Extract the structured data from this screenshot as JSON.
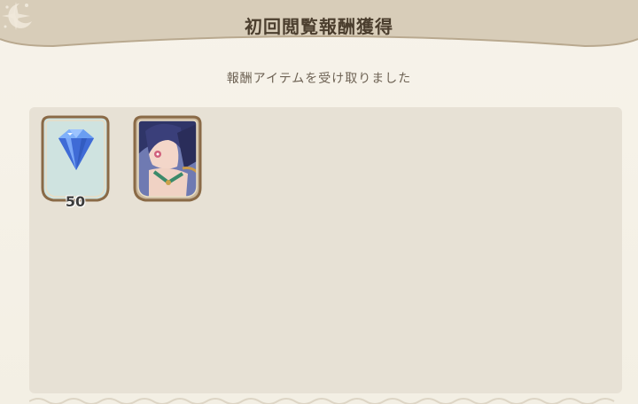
{
  "dialog": {
    "title": "初回閲覧報酬獲得",
    "message": "報酬アイテムを受け取りました"
  },
  "rewards": [
    {
      "item": "gem",
      "icon": "gem-icon",
      "quantity": "50"
    },
    {
      "item": "character",
      "icon": "character-portrait"
    }
  ],
  "colors": {
    "banner": "#d8cdb9",
    "banner_border": "#b9a98f",
    "title_text": "#4b3e2e",
    "panel": "#e7e1d5",
    "frame": "#8a6a47"
  }
}
